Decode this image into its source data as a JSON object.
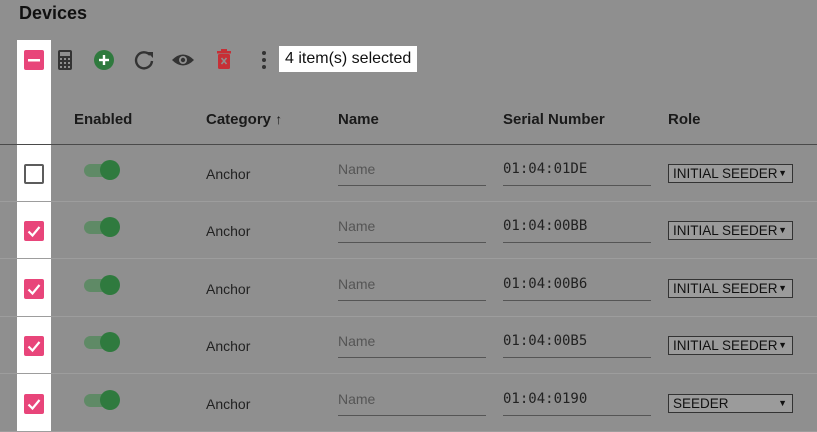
{
  "page": {
    "title": "Devices"
  },
  "toolbar": {
    "selected_label": "4 item(s) selected",
    "icons": [
      "minus-checkbox-icon",
      "calculator-icon",
      "add-circle-icon",
      "refresh-icon",
      "eye-icon",
      "delete-icon",
      "more-vert-icon"
    ],
    "colors": {
      "accent": "#e8457a",
      "add": "#2f7a3e",
      "delete": "#c62f36"
    }
  },
  "table": {
    "columns": {
      "enabled": "Enabled",
      "category": "Category",
      "name": "Name",
      "serial": "Serial Number",
      "role": "Role"
    },
    "sort_indicator": "↑",
    "rows": [
      {
        "checked": false,
        "enabled": true,
        "category": "Anchor",
        "name_placeholder": "Name",
        "serial": "01:04:01DE",
        "role": "INITIAL SEEDER"
      },
      {
        "checked": true,
        "enabled": true,
        "category": "Anchor",
        "name_placeholder": "Name",
        "serial": "01:04:00BB",
        "role": "INITIAL SEEDER"
      },
      {
        "checked": true,
        "enabled": true,
        "category": "Anchor",
        "name_placeholder": "Name",
        "serial": "01:04:00B6",
        "role": "INITIAL SEEDER"
      },
      {
        "checked": true,
        "enabled": true,
        "category": "Anchor",
        "name_placeholder": "Name",
        "serial": "01:04:00B5",
        "role": "INITIAL SEEDER"
      },
      {
        "checked": true,
        "enabled": true,
        "category": "Anchor",
        "name_placeholder": "Name",
        "serial": "01:04:0190",
        "role": "SEEDER"
      }
    ]
  }
}
